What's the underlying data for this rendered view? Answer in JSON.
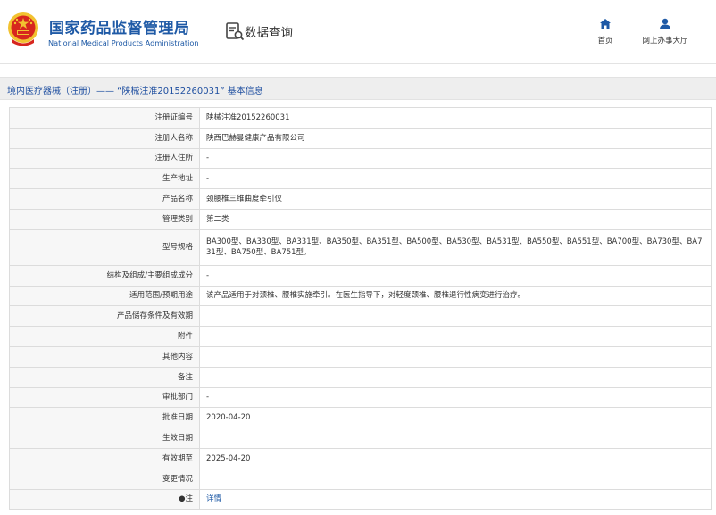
{
  "header": {
    "site_name_cn": "国家药品监督管理局",
    "site_name_en": "National Medical Products Administration",
    "query_title": "数据查询",
    "nav": {
      "home_label": "首页",
      "hall_label": "网上办事大厅"
    }
  },
  "page_title": "境内医疗器械（注册）—— “陕械注准20152260031” 基本信息",
  "rows": [
    {
      "label": "注册证编号",
      "value": "陕械注准20152260031"
    },
    {
      "label": "注册人名称",
      "value": "陕西巴赫曼健康产品有限公司"
    },
    {
      "label": "注册人住所",
      "value": "-"
    },
    {
      "label": "生产地址",
      "value": "-"
    },
    {
      "label": "产品名称",
      "value": "颈腰椎三维曲度牵引仪"
    },
    {
      "label": "管理类别",
      "value": "第二类"
    },
    {
      "label": "型号规格",
      "value": "BA300型、BA330型、BA331型、BA350型、BA351型、BA500型、BA530型、BA531型、BA550型、BA551型、BA700型、BA730型、BA731型、BA750型、BA751型。"
    },
    {
      "label": "结构及组成/主要组成成分",
      "value": "-"
    },
    {
      "label": "适用范围/预期用途",
      "value": "该产品适用于对颈椎、腰椎实施牵引。在医生指导下，对轻度颈椎、腰椎退行性病变进行治疗。"
    },
    {
      "label": "产品储存条件及有效期",
      "value": ""
    },
    {
      "label": "附件",
      "value": ""
    },
    {
      "label": "其他内容",
      "value": ""
    },
    {
      "label": "备注",
      "value": ""
    },
    {
      "label": "审批部门",
      "value": "-"
    },
    {
      "label": "批准日期",
      "value": "2020-04-20"
    },
    {
      "label": "生效日期",
      "value": ""
    },
    {
      "label": "有效期至",
      "value": "2025-04-20"
    },
    {
      "label": "变更情况",
      "value": ""
    },
    {
      "label": "●注",
      "value": "详情"
    }
  ],
  "colors": {
    "brand_blue": "#1f5aa6",
    "emblem_red": "#d7261e",
    "emblem_gold": "#f2c230"
  },
  "icons": {
    "emblem": "national-emblem",
    "query": "document-search-icon",
    "home": "home-icon",
    "hall": "user-icon"
  }
}
